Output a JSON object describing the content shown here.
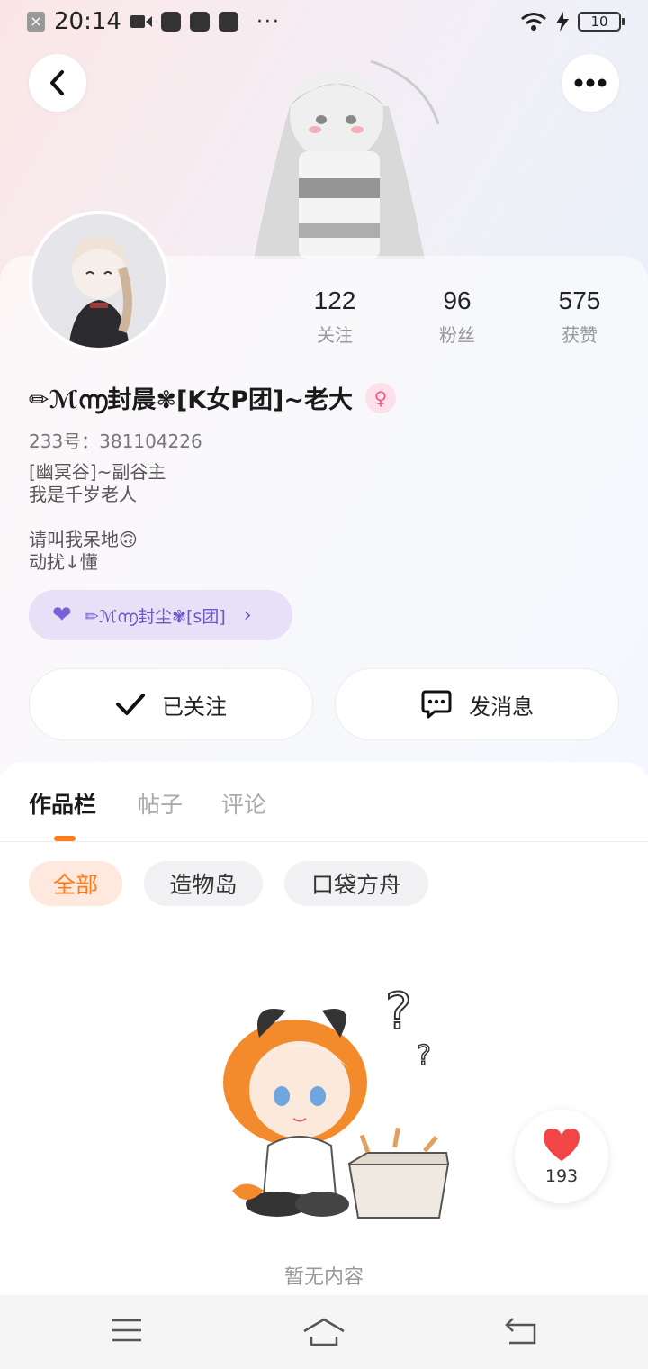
{
  "status_bar": {
    "time": "20:14",
    "dots": "···",
    "battery": "10"
  },
  "header": {
    "back_icon": "chevron-left-icon",
    "more_icon": "more-dots-icon"
  },
  "profile": {
    "stats": [
      {
        "value": "122",
        "label": "关注"
      },
      {
        "value": "96",
        "label": "粉丝"
      },
      {
        "value": "575",
        "label": "获赞"
      }
    ],
    "nickname": "✏ℳ൬封晨✾[K女P团]~老大",
    "gender": "female",
    "uid": "233号：381104226",
    "bio_lines": [
      "[幽冥谷]~副谷主",
      "我是千岁老人",
      "",
      "请叫我呆地🙃",
      "动扰↓懂"
    ],
    "group": {
      "label": "✏ℳ൬封尘✾[s团]"
    },
    "follow_button": "已关注",
    "message_button": "发消息"
  },
  "tabs": [
    "作品栏",
    "帖子",
    "评论"
  ],
  "filters": [
    "全部",
    "造物岛",
    "口袋方舟"
  ],
  "empty_state": "暂无内容",
  "like_float": {
    "count": "193"
  },
  "colors": {
    "accent": "#ff7a1a",
    "purple": "#7b61d6",
    "pink": "#ef5a8a"
  }
}
